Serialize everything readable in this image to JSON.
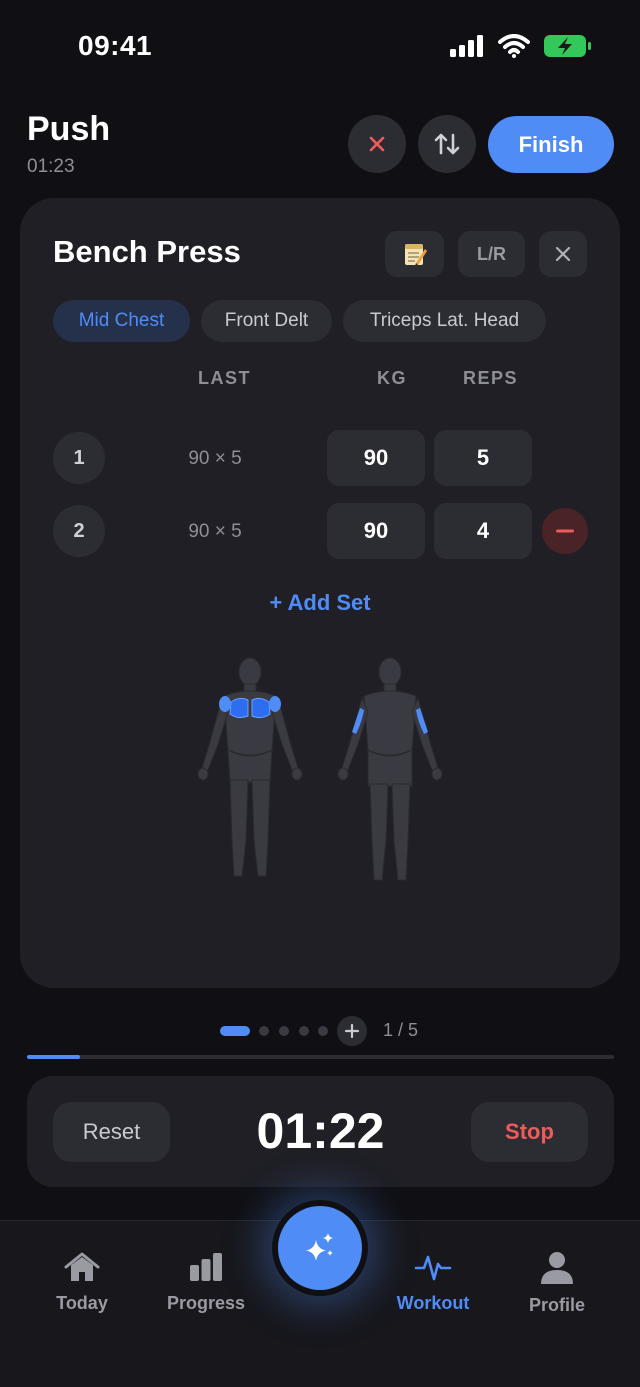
{
  "status_bar": {
    "time": "09:41"
  },
  "header": {
    "title": "Push",
    "elapsed": "01:23",
    "finish_label": "Finish"
  },
  "exercise": {
    "name": "Bench Press",
    "lr_label": "L/R",
    "muscles": [
      {
        "label": "Mid Chest",
        "active": true
      },
      {
        "label": "Front Delt",
        "active": false
      },
      {
        "label": "Triceps Lat. Head",
        "active": false
      }
    ],
    "columns": {
      "last": "LAST",
      "kg": "KG",
      "reps": "REPS"
    },
    "sets": [
      {
        "number": "1",
        "last": "90 × 5",
        "kg": "90",
        "reps": "5"
      },
      {
        "number": "2",
        "last": "90 × 5",
        "kg": "90",
        "reps": "4"
      }
    ],
    "add_set_label": "+ Add Set"
  },
  "pager": {
    "count": "1 / 5",
    "current": 1,
    "total": 5
  },
  "workout_progress": 0.09,
  "rest_timer": {
    "reset_label": "Reset",
    "time": "01:22",
    "stop_label": "Stop"
  },
  "tab_bar": {
    "tabs": [
      {
        "label": "Today",
        "icon": "home-icon"
      },
      {
        "label": "Progress",
        "icon": "bar-chart-icon"
      },
      {
        "label": "Workout",
        "icon": "pulse-icon",
        "active": true
      },
      {
        "label": "Profile",
        "icon": "person-icon"
      }
    ],
    "fab_icon": "sparkles-icon"
  },
  "colors": {
    "accent": "#4f8cf6",
    "danger": "#ef5b5b",
    "background": "#101014",
    "card": "#1f1f25"
  }
}
